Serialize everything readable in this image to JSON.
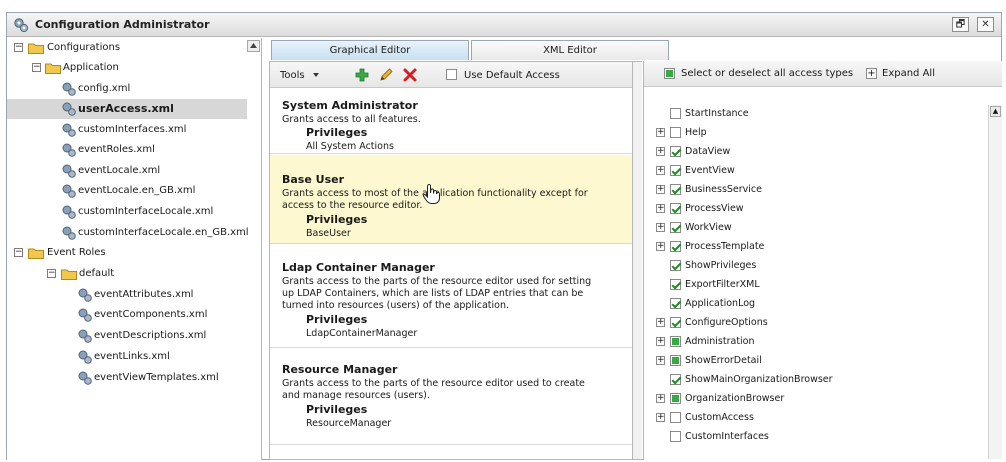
{
  "window": {
    "title": "Configuration Administrator",
    "restore_glyph": "🗗",
    "close_glyph": "✕"
  },
  "tree": {
    "items": [
      {
        "label": "Configurations",
        "type": "folder",
        "toggle": "−"
      },
      {
        "label": "Application",
        "type": "folder",
        "toggle": "−"
      },
      {
        "label": "config.xml",
        "type": "file"
      },
      {
        "label": "userAccess.xml",
        "type": "file",
        "selected": true
      },
      {
        "label": "customInterfaces.xml",
        "type": "file"
      },
      {
        "label": "eventRoles.xml",
        "type": "file"
      },
      {
        "label": "eventLocale.xml",
        "type": "file"
      },
      {
        "label": "eventLocale.en_GB.xml",
        "type": "file"
      },
      {
        "label": "customInterfaceLocale.xml",
        "type": "file"
      },
      {
        "label": "customInterfaceLocale.en_GB.xml",
        "type": "file"
      },
      {
        "label": "Event Roles",
        "type": "folder",
        "toggle": "−"
      },
      {
        "label": "default",
        "type": "folder",
        "toggle": "−"
      },
      {
        "label": "eventAttributes.xml",
        "type": "file"
      },
      {
        "label": "eventComponents.xml",
        "type": "file"
      },
      {
        "label": "eventDescriptions.xml",
        "type": "file"
      },
      {
        "label": "eventLinks.xml",
        "type": "file"
      },
      {
        "label": "eventViewTemplates.xml",
        "type": "file"
      }
    ]
  },
  "tabs": [
    {
      "label": "Graphical Editor",
      "active": true
    },
    {
      "label": "XML Editor",
      "active": false
    }
  ],
  "toolbar": {
    "tools_label": "Tools",
    "use_default_label": "Use Default Access"
  },
  "roles": [
    {
      "name": "System Administrator",
      "desc": "Grants access to all features.",
      "privileges_label": "Privileges",
      "privileges": "All System Actions"
    },
    {
      "name": "Base User",
      "desc": "Grants access to most of the application functionality except for access to the resource editor.",
      "privileges_label": "Privileges",
      "privileges": "BaseUser",
      "highlighted": true
    },
    {
      "name": "Ldap Container Manager",
      "desc": "Grants access to the parts of the resource editor used for setting up LDAP Containers, which are lists of LDAP entries that can be turned into resources (users) of the application.",
      "privileges_label": "Privileges",
      "privileges": "LdapContainerManager"
    },
    {
      "name": "Resource Manager",
      "desc": "Grants access to the parts of the resource editor used to create and manage resources (users).",
      "privileges_label": "Privileges",
      "privileges": "ResourceManager"
    }
  ],
  "access": {
    "select_all_label": "Select or deselect all access types",
    "expand_all_label": "Expand All",
    "items": [
      {
        "label": "StartInstance",
        "expandable": false,
        "state": "unchecked"
      },
      {
        "label": "Help",
        "expandable": true,
        "state": "unchecked"
      },
      {
        "label": "DataView",
        "expandable": true,
        "state": "checked"
      },
      {
        "label": "EventView",
        "expandable": true,
        "state": "checked"
      },
      {
        "label": "BusinessService",
        "expandable": true,
        "state": "checked"
      },
      {
        "label": "ProcessView",
        "expandable": true,
        "state": "checked"
      },
      {
        "label": "WorkView",
        "expandable": true,
        "state": "checked"
      },
      {
        "label": "ProcessTemplate",
        "expandable": true,
        "state": "checked"
      },
      {
        "label": "ShowPrivileges",
        "expandable": false,
        "state": "checked"
      },
      {
        "label": "ExportFilterXML",
        "expandable": false,
        "state": "checked"
      },
      {
        "label": "ApplicationLog",
        "expandable": false,
        "state": "checked"
      },
      {
        "label": "ConfigureOptions",
        "expandable": true,
        "state": "checked"
      },
      {
        "label": "Administration",
        "expandable": true,
        "state": "partial"
      },
      {
        "label": "ShowErrorDetail",
        "expandable": true,
        "state": "partial"
      },
      {
        "label": "ShowMainOrganizationBrowser",
        "expandable": false,
        "state": "checked"
      },
      {
        "label": "OrganizationBrowser",
        "expandable": true,
        "state": "partial"
      },
      {
        "label": "CustomAccess",
        "expandable": true,
        "state": "unchecked"
      },
      {
        "label": "CustomInterfaces",
        "expandable": false,
        "state": "unchecked"
      }
    ]
  },
  "colors": {
    "accent": "#3aa845",
    "highlight": "#fdf8cf",
    "selected": "#d7d7d7"
  }
}
